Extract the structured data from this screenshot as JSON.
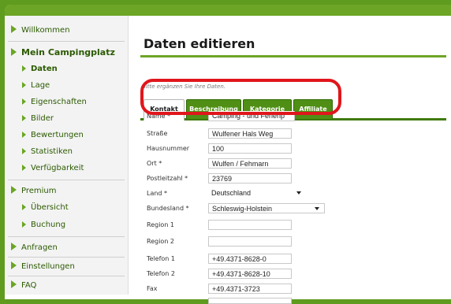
{
  "sidebar": {
    "items": [
      {
        "label": "Willkommen",
        "level": "top"
      },
      {
        "label": "Mein Campingplatz",
        "level": "top",
        "bold": true
      },
      {
        "label": "Daten",
        "level": "sub",
        "bold": true
      },
      {
        "label": "Lage",
        "level": "sub"
      },
      {
        "label": "Eigenschaften",
        "level": "sub"
      },
      {
        "label": "Bilder",
        "level": "sub"
      },
      {
        "label": "Bewertungen",
        "level": "sub"
      },
      {
        "label": "Statistiken",
        "level": "sub"
      },
      {
        "label": "Verfügbarkeit",
        "level": "sub"
      },
      {
        "label": "Premium",
        "level": "top"
      },
      {
        "label": "Übersicht",
        "level": "sub"
      },
      {
        "label": "Buchung",
        "level": "sub"
      },
      {
        "label": "Anfragen",
        "level": "top"
      },
      {
        "label": "Einstellungen",
        "level": "top"
      },
      {
        "label": "FAQ",
        "level": "top"
      }
    ]
  },
  "main": {
    "title": "Daten editieren",
    "hint": "Bitte ergänzen Sie Ihre Daten.",
    "tabs": [
      {
        "label": "Kontakt",
        "active": true
      },
      {
        "label": "Beschreibung",
        "active": false
      },
      {
        "label": "Kategorie",
        "active": false
      },
      {
        "label": "Affiliate",
        "active": false
      }
    ],
    "fields": [
      {
        "label": "Name *",
        "value": "Camping - und Ferienp",
        "type": "text"
      },
      {
        "label": "Straße",
        "value": "Wulfener Hals Weg",
        "type": "text"
      },
      {
        "label": "Hausnummer",
        "value": "100",
        "type": "text"
      },
      {
        "label": "Ort *",
        "value": "Wulfen / Fehmarn",
        "type": "text"
      },
      {
        "label": "Postleitzahl *",
        "value": "23769",
        "type": "text"
      },
      {
        "label": "Land *",
        "value": "Deutschland",
        "type": "select"
      },
      {
        "label": "Bundesland *",
        "value": "Schleswig-Holstein",
        "type": "select"
      },
      {
        "label": "Region 1",
        "value": "",
        "type": "text"
      },
      {
        "label": "Region 2",
        "value": "",
        "type": "text"
      },
      {
        "label": "Telefon 1",
        "value": "+49.4371-8628-0",
        "type": "text"
      },
      {
        "label": "Telefon 2",
        "value": "+49.4371-8628-10",
        "type": "text"
      },
      {
        "label": "Fax",
        "value": "+49.4371-3723",
        "type": "text"
      }
    ]
  },
  "colors": {
    "background": "#5f9b1e",
    "tab": "#4f8f15",
    "highlight": "#e0161c",
    "accent": "#6da526"
  }
}
